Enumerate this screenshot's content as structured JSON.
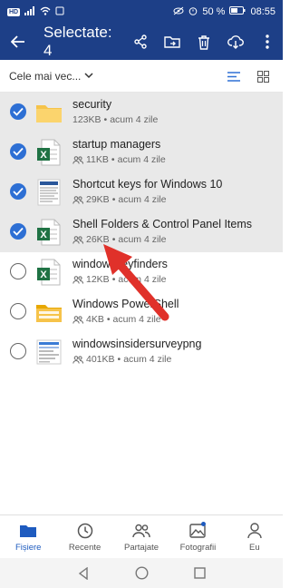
{
  "status_bar": {
    "carrier_badge": "HD",
    "battery": "50 %",
    "time": "08:55"
  },
  "app_bar": {
    "title": "Selectate: 4",
    "actions": [
      "share-icon",
      "move-to-folder-icon",
      "delete-icon",
      "download-icon",
      "more-icon"
    ]
  },
  "sort": {
    "label": "Cele mai vec..."
  },
  "files": [
    {
      "name": "security",
      "size": "123KB",
      "date": "acum 4 zile",
      "type": "folder",
      "selected": true,
      "shared": false
    },
    {
      "name": "startup managers",
      "size": "11KB",
      "date": "acum 4 zile",
      "type": "excel",
      "selected": true,
      "shared": true
    },
    {
      "name": "Shortcut keys for Windows 10",
      "size": "29KB",
      "date": "acum 4 zile",
      "type": "word",
      "selected": true,
      "shared": true
    },
    {
      "name": "Shell Folders & Control Panel Items",
      "size": "26KB",
      "date": "acum 4 zile",
      "type": "excel",
      "selected": true,
      "shared": true
    },
    {
      "name": "windowskeyfinders",
      "size": "12KB",
      "date": "acum 4 zile",
      "type": "excel",
      "selected": false,
      "shared": true
    },
    {
      "name": "Windows PowerShell",
      "size": "4KB",
      "date": "acum 4 zile",
      "type": "folder-yellow",
      "selected": false,
      "shared": true
    },
    {
      "name": "windowsinsidersurveypng",
      "size": "401KB",
      "date": "acum 4 zile",
      "type": "image",
      "selected": false,
      "shared": true
    }
  ],
  "bottom_nav": [
    {
      "label": "Fișiere",
      "active": true
    },
    {
      "label": "Recente",
      "active": false
    },
    {
      "label": "Partajate",
      "active": false
    },
    {
      "label": "Fotografii",
      "active": false
    },
    {
      "label": "Eu",
      "active": false
    }
  ],
  "colors": {
    "bar": "#1d3f87",
    "accent": "#2d6fd4",
    "annotation_arrow": "#e0312a"
  }
}
